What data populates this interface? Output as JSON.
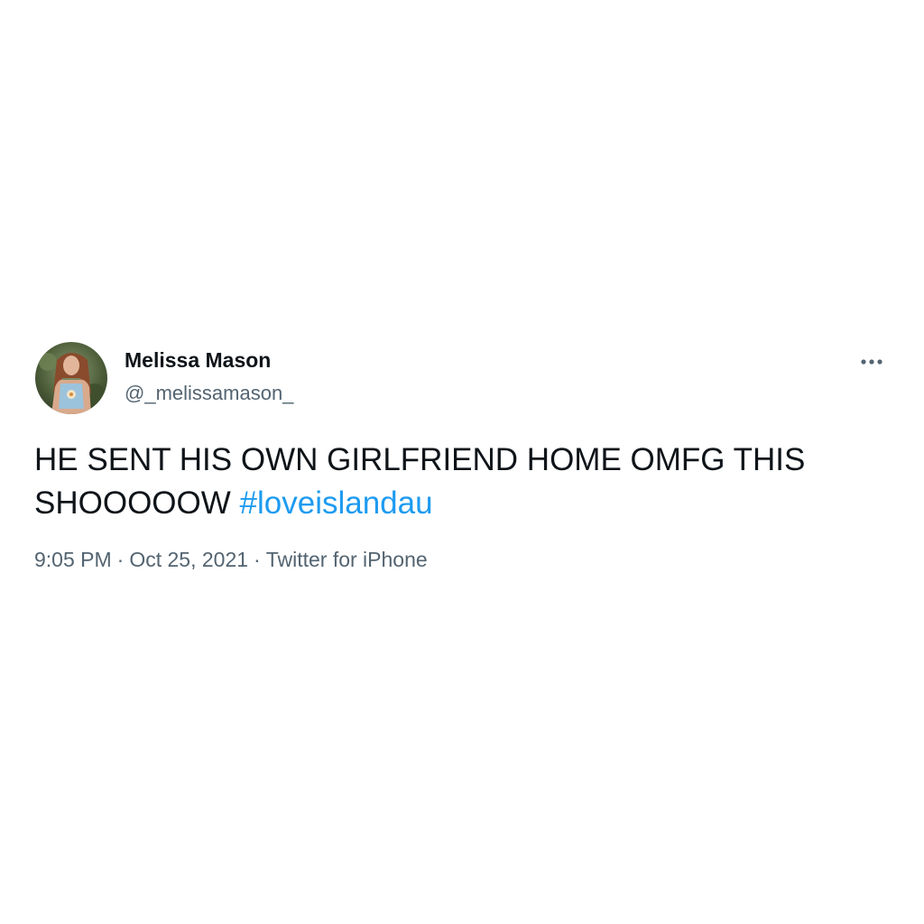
{
  "tweet": {
    "author": {
      "display_name": "Melissa Mason",
      "handle": "@_melissamason_",
      "avatar_icon": "profile-photo-avatar"
    },
    "more_icon": "more-horizontal-icon",
    "text": "HE SENT HIS OWN GIRLFRIEND HOME OMFG THIS SHOOOOOW",
    "hashtag": "#loveislandau",
    "time": "9:05 PM",
    "separator": "·",
    "date": "Oct 25, 2021",
    "source": "Twitter for iPhone"
  },
  "colors": {
    "text": "#0f1419",
    "secondary": "#536471",
    "link": "#1d9bf0",
    "background": "#ffffff"
  }
}
